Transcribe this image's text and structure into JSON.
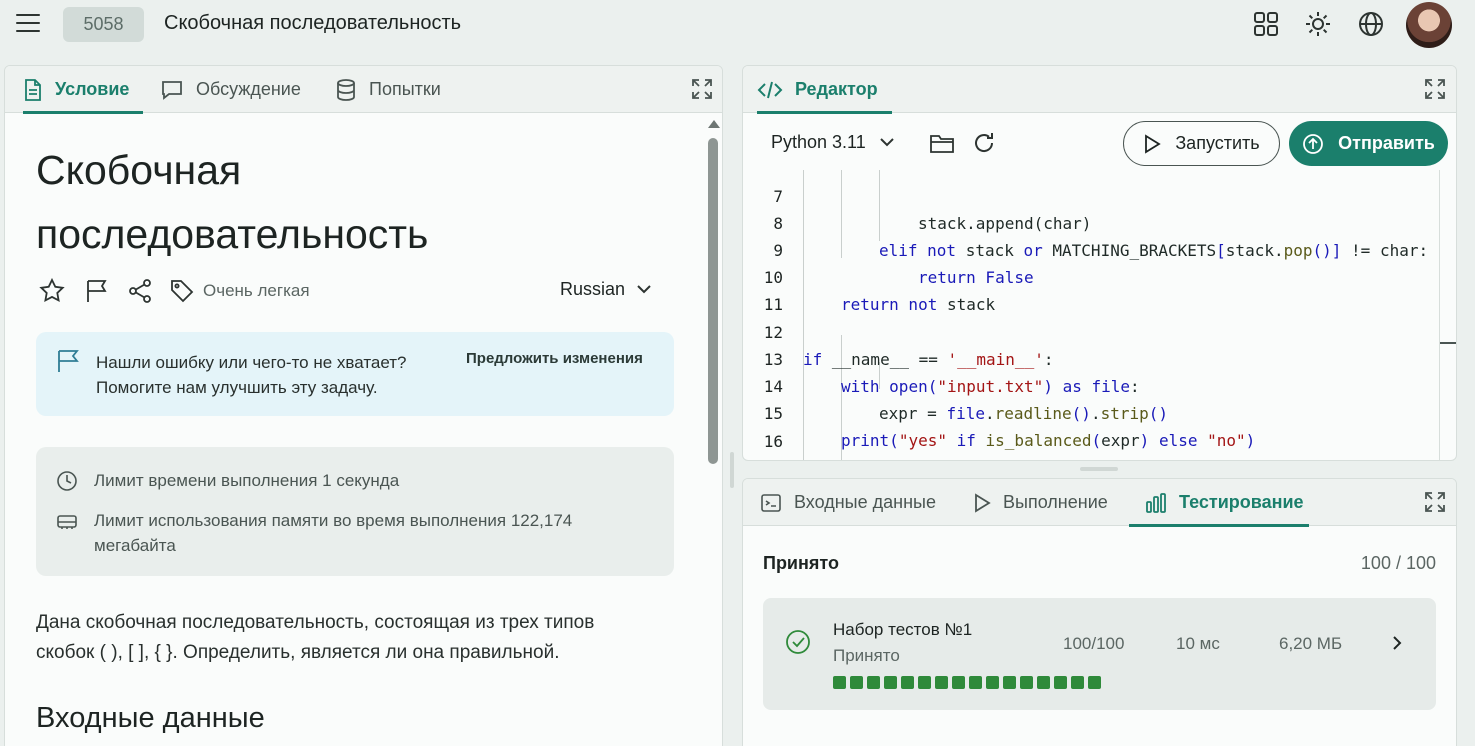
{
  "header": {
    "problem_id": "5058",
    "title": "Скобочная последовательность"
  },
  "left_panel": {
    "tabs": [
      {
        "label": "Условие",
        "icon": "document-icon",
        "active": true
      },
      {
        "label": "Обсуждение",
        "icon": "chat-icon",
        "active": false
      },
      {
        "label": "Попытки",
        "icon": "database-icon",
        "active": false
      }
    ],
    "heading": "Скобочная последовательность",
    "difficulty": "Очень легкая",
    "language": "Russian",
    "notice": {
      "line1": "Нашли ошибку или чего-то не хватает?",
      "line2": "Помогите нам улучшить эту задачу.",
      "link": "Предложить изменения"
    },
    "limits": {
      "time": "Лимит времени выполнения 1 секунда",
      "memory_line1": "Лимит использования памяти во время выполнения 122,174",
      "memory_line2": "мегабайта"
    },
    "description_line1": "Дана скобочная последовательность, состоящая из трех типов",
    "description_line2": "скобок ( ), [ ], { }. Определить, является ли она правильной.",
    "section_title": "Входные данные"
  },
  "editor": {
    "tab_label": "Редактор",
    "python_version": "Python 3.11",
    "run_label": "Запустить",
    "submit_label": "Отправить",
    "partial_line": "stack.append(char)",
    "line_numbers": [
      "7",
      "8",
      "9",
      "10",
      "11",
      "12",
      "13",
      "14",
      "15",
      "16"
    ]
  },
  "bottom_panel": {
    "tabs": [
      {
        "label": "Входные данные",
        "icon": "terminal-icon",
        "active": false
      },
      {
        "label": "Выполнение",
        "icon": "play-icon",
        "active": false
      },
      {
        "label": "Тестирование",
        "icon": "bar-chart-icon",
        "active": true
      }
    ],
    "status": "Принято",
    "score": "100 / 100",
    "test_set": {
      "name": "Набор тестов №1",
      "status": "Принято",
      "score": "100/100",
      "time": "10 мс",
      "memory": "6,20 МБ",
      "passed_tests": 16
    }
  },
  "colors": {
    "accent": "#1b7f6c",
    "background": "#ebf0ee",
    "notice_bg": "#e4f4f9",
    "passed": "#2f8a3a"
  }
}
